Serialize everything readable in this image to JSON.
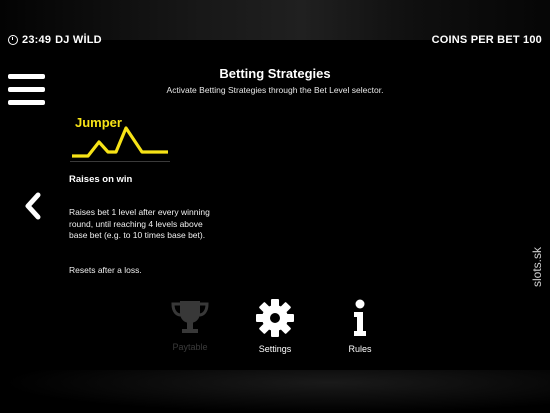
{
  "status_bar": {
    "time": "23:49",
    "game_name": "DJ WİLD",
    "coins_label": "COINS PER BET 100"
  },
  "header": {
    "title": "Betting Strategies",
    "subtitle": "Activate Betting Strategies through the Bet Level selector."
  },
  "strategy": {
    "name": "Jumper",
    "heading": "Raises on win",
    "description": "Raises bet 1 level after every winning round, until reaching 4 levels above base bet (e.g. to 10 times base bet).",
    "reset_note": "Resets after a loss.",
    "accent_color": "#f7e317"
  },
  "watermark": "slots.sk",
  "bottom_nav": {
    "items": [
      {
        "label": "Paytable",
        "icon": "trophy-icon"
      },
      {
        "label": "Settings",
        "icon": "gear-icon"
      },
      {
        "label": "Rules",
        "icon": "info-icon"
      }
    ]
  }
}
